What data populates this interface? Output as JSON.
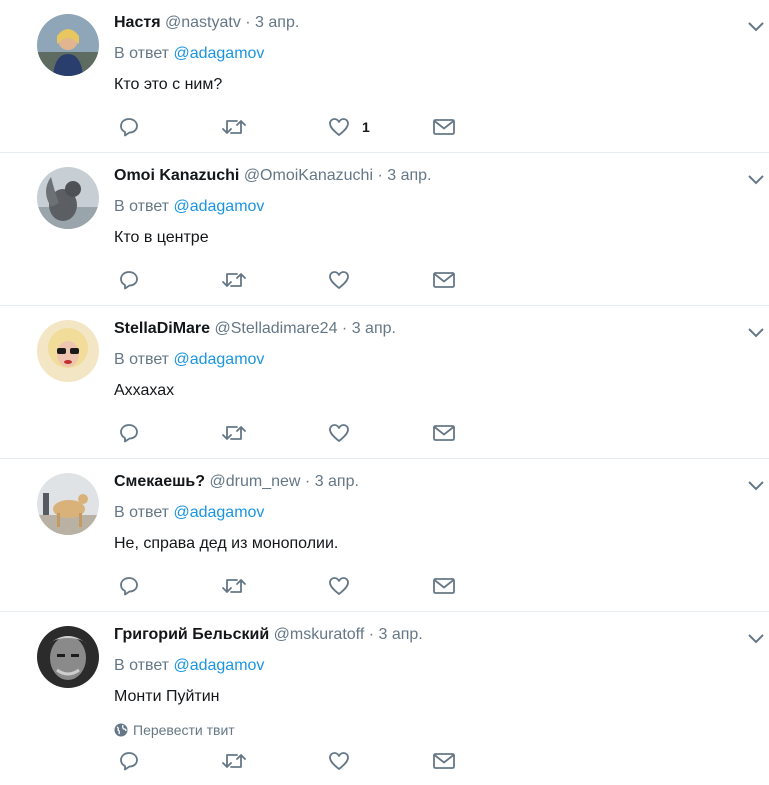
{
  "colors": {
    "link": "#1b95e0",
    "muted": "#657786",
    "text": "#14171a",
    "divider": "#e6ecf0"
  },
  "reply_prefix": "В ответ",
  "translate_label": "Перевести твит",
  "tweets": [
    {
      "name": "Настя",
      "handle": "@nastyatv",
      "sep": "·",
      "time": "3 апр.",
      "reply_to": "@adagamov",
      "text": "Кто это с ним?",
      "likes": "1"
    },
    {
      "name": "Omoi Kanazuchi",
      "handle": "@OmoiKanazuchi",
      "sep": "·",
      "time": "3 апр.",
      "reply_to": "@adagamov",
      "text": "Кто в центре",
      "likes": ""
    },
    {
      "name": "StellaDiMare",
      "handle": "@Stelladimare24",
      "sep": "·",
      "time": "3 апр.",
      "reply_to": "@adagamov",
      "text": "Аххахах",
      "likes": ""
    },
    {
      "name": "Смекаешь?",
      "handle": "@drum_new",
      "sep": "·",
      "time": "3 апр.",
      "reply_to": "@adagamov",
      "text": "Не, справа дед из монополии.",
      "likes": ""
    },
    {
      "name": "Григорий Бельский",
      "handle": "@mskuratoff",
      "sep": "·",
      "time": "3 апр.",
      "reply_to": "@adagamov",
      "text": "Монти Пуйтин",
      "likes": ""
    }
  ]
}
